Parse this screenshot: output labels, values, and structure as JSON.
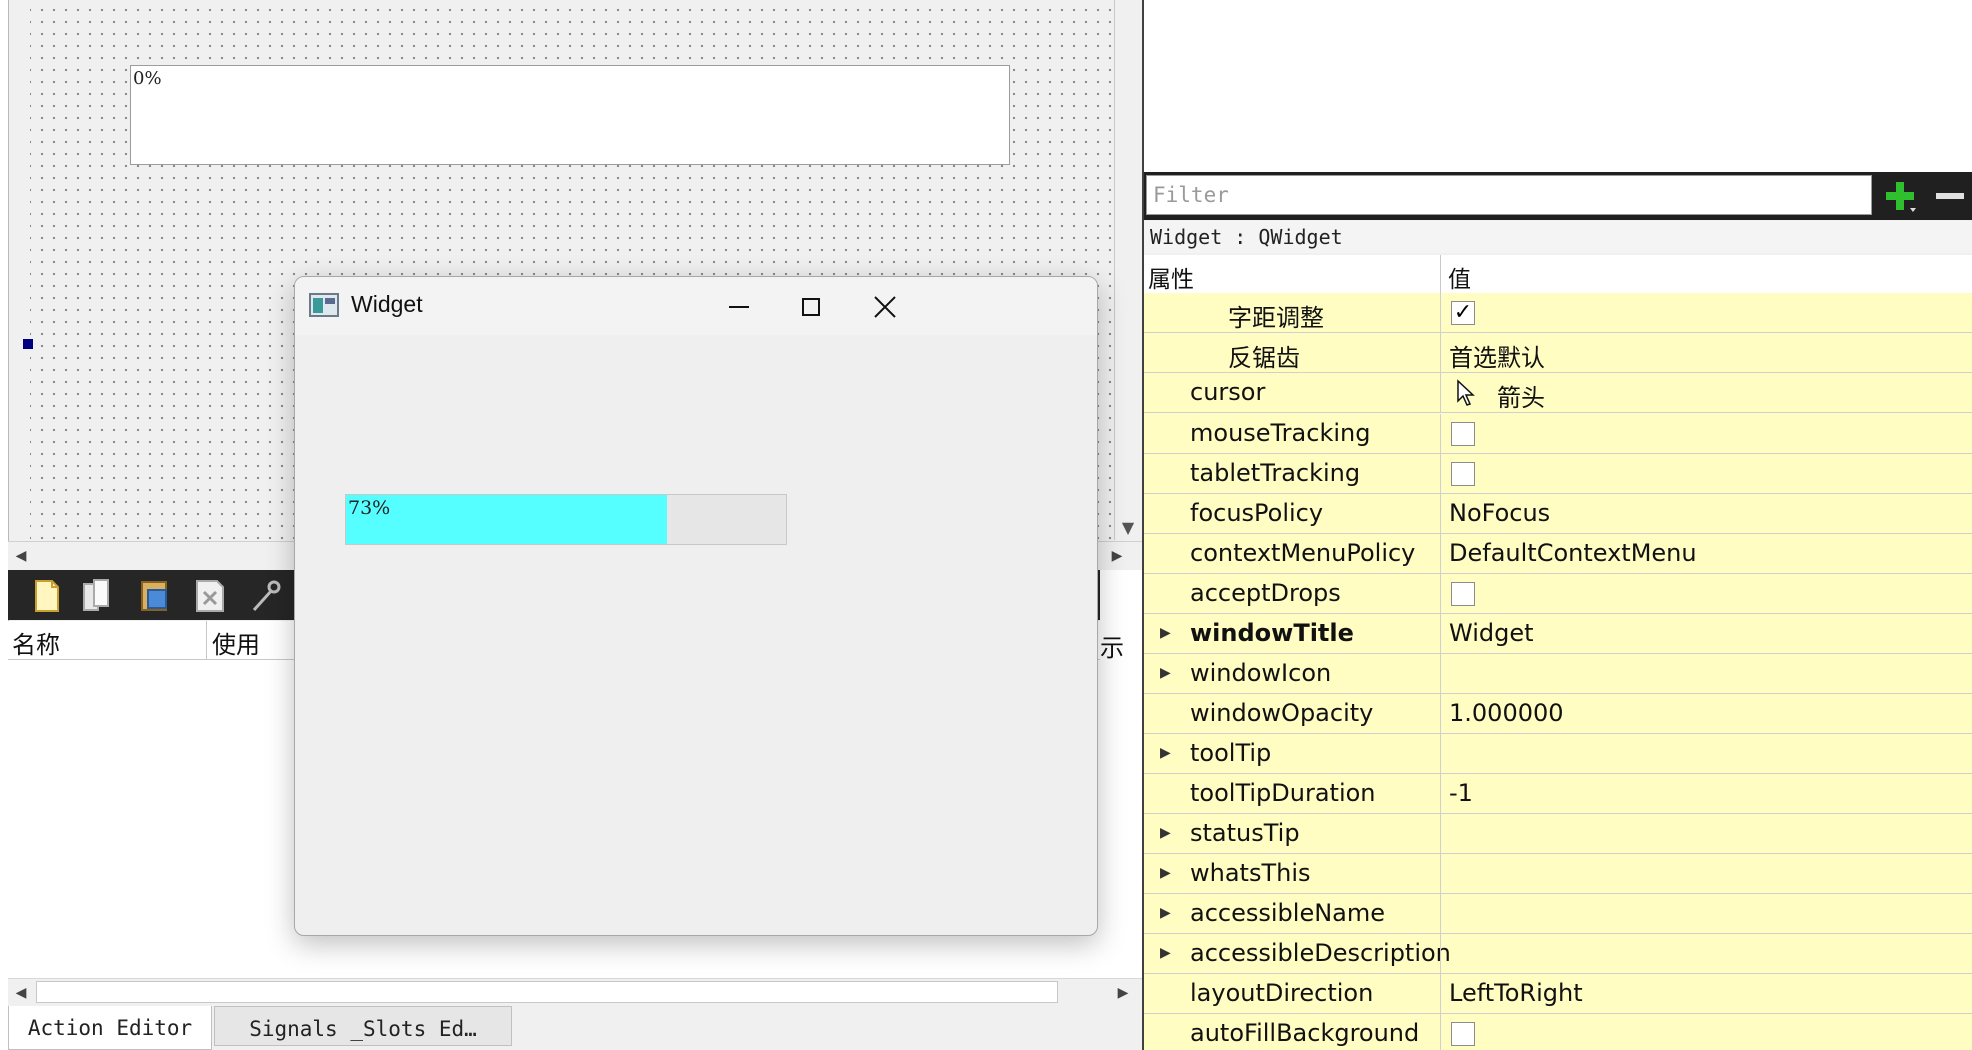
{
  "designer": {
    "progress_text": "0%"
  },
  "action_editor": {
    "columns": [
      "名称",
      "使用"
    ],
    "partial_column": "示"
  },
  "bottom_tabs": [
    "Action Editor",
    "Signals _Slots Ed…"
  ],
  "property_editor": {
    "filter_placeholder": "Filter",
    "class_label": "Widget : QWidget",
    "header": {
      "property": "属性",
      "value": "值"
    },
    "rows": [
      {
        "name": "字距调整",
        "type": "check",
        "checked": true
      },
      {
        "name": "反锯齿",
        "value": "首选默认"
      },
      {
        "name": "cursor",
        "value": "箭头",
        "icon": "arrow-cursor-icon"
      },
      {
        "name": "mouseTracking",
        "type": "check",
        "checked": false
      },
      {
        "name": "tabletTracking",
        "type": "check",
        "checked": false
      },
      {
        "name": "focusPolicy",
        "value": "NoFocus"
      },
      {
        "name": "contextMenuPolicy",
        "value": "DefaultContextMenu"
      },
      {
        "name": "acceptDrops",
        "type": "check",
        "checked": false
      },
      {
        "name": "windowTitle",
        "value": "Widget",
        "bold": true,
        "expandable": true
      },
      {
        "name": "windowIcon",
        "value": "",
        "expandable": true
      },
      {
        "name": "windowOpacity",
        "value": "1.000000"
      },
      {
        "name": "toolTip",
        "value": "",
        "expandable": true
      },
      {
        "name": "toolTipDuration",
        "value": "-1"
      },
      {
        "name": "statusTip",
        "value": "",
        "expandable": true
      },
      {
        "name": "whatsThis",
        "value": "",
        "expandable": true
      },
      {
        "name": "accessibleName",
        "value": "",
        "expandable": true
      },
      {
        "name": "accessibleDescription",
        "value": "",
        "expandable": true
      },
      {
        "name": "layoutDirection",
        "value": "LeftToRight"
      },
      {
        "name": "autoFillBackground",
        "type": "check",
        "checked": false
      }
    ]
  },
  "widget_window": {
    "title": "Widget",
    "progress_text": "73%",
    "progress_value": 0.73,
    "fill_color": "#55ffff"
  }
}
